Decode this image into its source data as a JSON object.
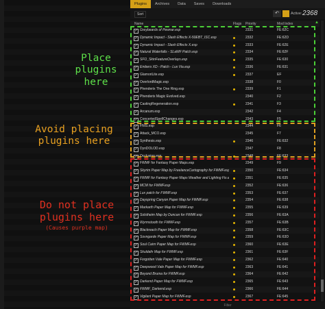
{
  "tabs": [
    "Plugins",
    "Archives",
    "Data",
    "Saves",
    "Downloads"
  ],
  "toolbar": {
    "sort_label": "Sort",
    "active_label": "Active:",
    "active_count": "2368"
  },
  "columns": {
    "name": "Name",
    "flags": "Flags",
    "priority": "Priority",
    "mod_index": "Mod Index"
  },
  "filter_label": "Filter",
  "annotations": {
    "green": "Place plugins here",
    "orange": "Avoid placing plugins here",
    "red": "Do not place plugins here",
    "red_sub": "(Causes purple map)"
  },
  "rows": [
    {
      "name": "Greybeards of Pewnar.esp",
      "it": true,
      "dot": false,
      "pri": "2331",
      "mi": "FE:62C"
    },
    {
      "name": "Dynamic Impact - Slash Effects X-50EBT_ISC.esp",
      "it": true,
      "dot": true,
      "pri": "2332",
      "mi": "FE:62D"
    },
    {
      "name": "Dynamic Impact - Slash Effects X.esp",
      "it": true,
      "dot": true,
      "pri": "2333",
      "mi": "FE:62E"
    },
    {
      "name": "Natural Waterfalls - SLaWF Patch.esp",
      "it": true,
      "dot": true,
      "pri": "2334",
      "mi": "FE:62F"
    },
    {
      "name": "SFO_SkinFeatureOverlays.esp",
      "it": true,
      "dot": true,
      "pri": "2335",
      "mi": "FE:630"
    },
    {
      "name": "Embers XD - Patch - Lux Via.esp",
      "it": true,
      "dot": true,
      "pri": "2336",
      "mi": "FE:631"
    },
    {
      "name": "GlamoriLite.esp",
      "it": false,
      "dot": true,
      "pri": "2337",
      "mi": "EF"
    },
    {
      "name": "OverlordMagic.esp",
      "it": false,
      "dot": false,
      "pri": "2338",
      "mi": "F0"
    },
    {
      "name": "Phenderix The One Ring.esp",
      "it": false,
      "dot": true,
      "pri": "2339",
      "mi": "F1"
    },
    {
      "name": "Phenderix Magic Evolved.esp",
      "it": false,
      "dot": false,
      "pri": "2340",
      "mi": "F2"
    },
    {
      "name": "CastingRegeneration.esp",
      "it": false,
      "dot": true,
      "pri": "2341",
      "mi": "F3"
    },
    {
      "name": "Arcanum.esp",
      "it": false,
      "dot": false,
      "pri": "2342",
      "mi": "F4"
    },
    {
      "name": "ConcertedSpellChanges.esp",
      "it": false,
      "dot": false,
      "pri": "2343",
      "mi": "F5"
    },
    {
      "name": "FNIS.esp",
      "it": false,
      "dot": false,
      "pri": "2344",
      "mi": "F6"
    },
    {
      "name": "Attack_MCO.esp",
      "it": false,
      "dot": false,
      "pri": "2345",
      "mi": "F7"
    },
    {
      "name": "Synthesis.esp",
      "it": false,
      "dot": true,
      "pri": "2346",
      "mi": "FE:632"
    },
    {
      "name": "DynDOLOD.esp",
      "it": false,
      "dot": false,
      "pri": "2347",
      "mi": "F8"
    },
    {
      "name": "Occlusion.esp",
      "it": false,
      "dot": true,
      "pri": "2348",
      "mi": "FE:633"
    },
    {
      "name": "FWMF for Fantasy Paper Maps.esp",
      "it": false,
      "dot": false,
      "pri": "2349",
      "mi": "F9"
    },
    {
      "name": "Skyrim Paper Map by FreelanceCartography for FWMF.esp",
      "it": true,
      "dot": true,
      "pri": "2350",
      "mi": "FE:634"
    },
    {
      "name": "FWMF for Fantasy Paper Maps Weather and Lighting Fix.esp",
      "it": true,
      "dot": true,
      "pri": "2351",
      "mi": "FE:635"
    },
    {
      "name": "MCM for FWMF.esp",
      "it": true,
      "dot": true,
      "pri": "2352",
      "mi": "FE:636"
    },
    {
      "name": "Lux patch for FWMF.esp",
      "it": true,
      "dot": true,
      "pri": "2353",
      "mi": "FE:637"
    },
    {
      "name": "Dayspring Canyon Paper Map for FWMF.esp",
      "it": true,
      "dot": true,
      "pri": "2354",
      "mi": "FE:638"
    },
    {
      "name": "Markarth Paper Map for FWMF.esp",
      "it": true,
      "dot": true,
      "pri": "2355",
      "mi": "FE:639"
    },
    {
      "name": "Solstheim Map by Duncan for FWMF.esp",
      "it": true,
      "dot": true,
      "pri": "2356",
      "mi": "FE:63A"
    },
    {
      "name": "Wyrmstooth for FWMF.esp",
      "it": true,
      "dot": true,
      "pri": "2357",
      "mi": "FE:63B"
    },
    {
      "name": "Blackreach Paper Map for FWMF.esp",
      "it": true,
      "dot": true,
      "pri": "2358",
      "mi": "FE:63C"
    },
    {
      "name": "Sovngarde Paper Map for FWMF.esp",
      "it": true,
      "dot": true,
      "pri": "2359",
      "mi": "FE:63D"
    },
    {
      "name": "Soul Cairn Paper Map for FWMF.esp",
      "it": true,
      "dot": true,
      "pri": "2360",
      "mi": "FE:63E"
    },
    {
      "name": "Skuldafn Map for FWMF.esp",
      "it": true,
      "dot": true,
      "pri": "2361",
      "mi": "FE:63F"
    },
    {
      "name": "Forgotten Vale Paper Map for FWMF.esp",
      "it": true,
      "dot": true,
      "pri": "2362",
      "mi": "FE:640"
    },
    {
      "name": "Deepwood Vale Paper Map for FWMF.esp",
      "it": true,
      "dot": true,
      "pri": "2363",
      "mi": "FE:641"
    },
    {
      "name": "Beyond Bruma for FWMF.esp",
      "it": true,
      "dot": true,
      "pri": "2364",
      "mi": "FE:642"
    },
    {
      "name": "Darkend Paper Map for FWMF.esp",
      "it": true,
      "dot": true,
      "pri": "2365",
      "mi": "FE:643"
    },
    {
      "name": "FWMF_Darkend.esp",
      "it": true,
      "dot": true,
      "pri": "2366",
      "mi": "FE:644"
    },
    {
      "name": "Vigilant Paper Map for FWMF.esp",
      "it": true,
      "dot": true,
      "pri": "2367",
      "mi": "FE:645"
    }
  ]
}
